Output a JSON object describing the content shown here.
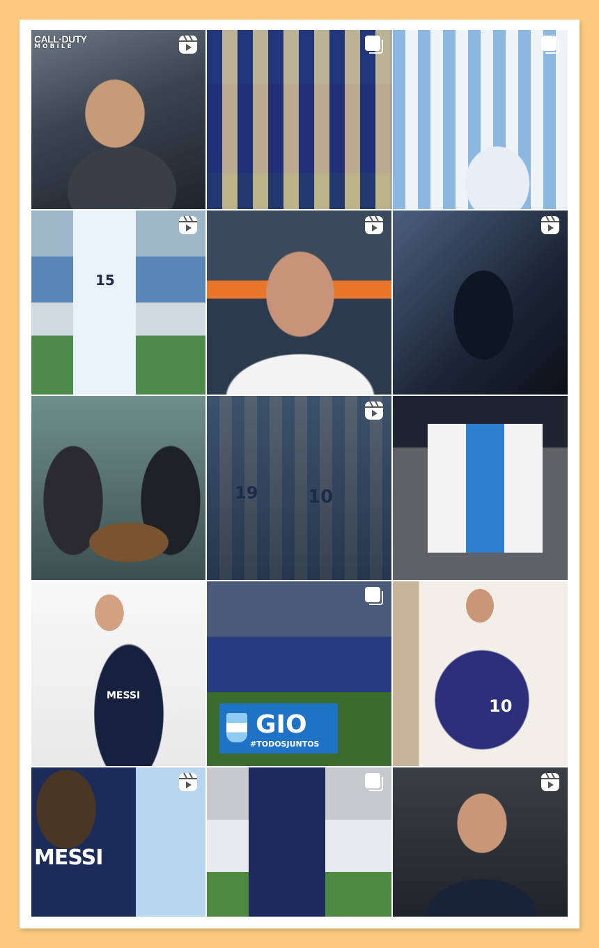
{
  "colors": {
    "page_background": "#fcc97e",
    "card_background": "#ffffff",
    "badge_color": "#ffffff"
  },
  "grid": {
    "tiles": [
      {
        "name": "tile-cod-mobile-soldier",
        "badge": "reel-icon",
        "overlay_text": {
          "logo_line1": "CALL·DUTY",
          "logo_line2": "MOBILE"
        }
      },
      {
        "name": "tile-team-huddle",
        "badge": "multi-photo-icon"
      },
      {
        "name": "tile-celebration-crowd",
        "badge": "multi-photo-icon"
      },
      {
        "name": "tile-jersey-15-pitch",
        "badge": "reel-icon"
      },
      {
        "name": "tile-portrait-stadium",
        "badge": "reel-icon"
      },
      {
        "name": "tile-dark-silhouette",
        "badge": "reel-icon"
      },
      {
        "name": "tile-chess-game",
        "badge": "none"
      },
      {
        "name": "tile-two-players-argentina",
        "badge": "reel-icon"
      },
      {
        "name": "tile-three-friends-night",
        "badge": "none"
      },
      {
        "name": "tile-hard-rock-hoodie",
        "badge": "none",
        "overlay_text": {
          "hoodie": "MESSI"
        }
      },
      {
        "name": "tile-team-photo-gio",
        "badge": "multi-photo-icon",
        "overlay_text": {
          "banner_big": "GIO",
          "banner_small": "#TODOSJUNTOS"
        }
      },
      {
        "name": "tile-purple-jersey-10",
        "badge": "none"
      },
      {
        "name": "tile-messi-19-back",
        "badge": "reel-icon",
        "overlay_text": {
          "jersey": "MESSI"
        }
      },
      {
        "name": "tile-psg-match",
        "badge": "multi-photo-icon"
      },
      {
        "name": "tile-portrait-jacket",
        "badge": "reel-icon"
      }
    ]
  }
}
